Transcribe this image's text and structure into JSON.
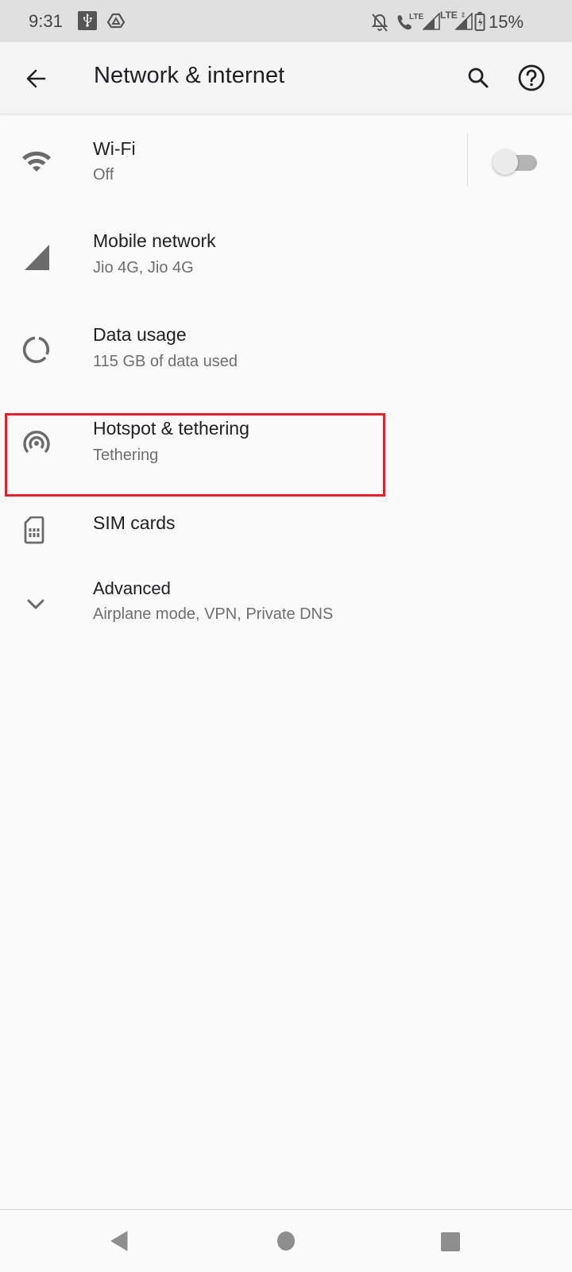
{
  "status_bar": {
    "time": "9:31",
    "left_icons": [
      "usb-icon",
      "drive-icon"
    ],
    "right_icons": [
      "notifications-off-icon",
      "volte-call-icon",
      "signal-icon",
      "lte-signal-icon",
      "battery-charging-icon"
    ],
    "volte_label": "LTE",
    "lte_label": "LTE",
    "battery_percent": "15%"
  },
  "app_bar": {
    "title": "Network & internet",
    "back_icon": "arrow-back-icon",
    "search_icon": "search-icon",
    "help_icon": "help-icon"
  },
  "items": [
    {
      "icon": "wifi-icon",
      "title": "Wi-Fi",
      "subtitle": "Off",
      "toggle": {
        "on": false
      }
    },
    {
      "icon": "mobile-signal-icon",
      "title": "Mobile network",
      "subtitle": "Jio 4G, Jio 4G"
    },
    {
      "icon": "data-usage-icon",
      "title": "Data usage",
      "subtitle": "115 GB of data used"
    },
    {
      "icon": "hotspot-icon",
      "title": "Hotspot & tethering",
      "subtitle": "Tethering",
      "highlighted": true
    },
    {
      "icon": "sim-card-icon",
      "title": "SIM cards"
    },
    {
      "icon": "chevron-down-icon",
      "title": "Advanced",
      "subtitle": "Airplane mode, VPN, Private DNS"
    }
  ],
  "highlight_color": "#e4202a",
  "nav_bar": {
    "back": "nav-back-icon",
    "home": "nav-home-icon",
    "recents": "nav-recents-icon"
  }
}
